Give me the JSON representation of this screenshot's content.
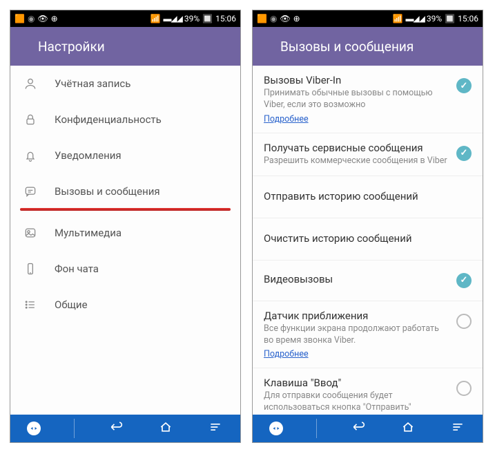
{
  "status": {
    "battery": "39%",
    "time": "15:06"
  },
  "screen1": {
    "title": "Настройки",
    "items": [
      {
        "label": "Учётная запись"
      },
      {
        "label": "Конфиденциальность"
      },
      {
        "label": "Уведомления"
      },
      {
        "label": "Вызовы и сообщения"
      },
      {
        "label": "Мультимедиа"
      },
      {
        "label": "Фон чата"
      },
      {
        "label": "Общие"
      }
    ]
  },
  "screen2": {
    "title": "Вызовы и сообщения",
    "rows": [
      {
        "title": "Вызовы Viber-In",
        "sub": "Принимать обычные вызовы с помощью Viber, если это возможно",
        "link": "Подробнее",
        "checked": true
      },
      {
        "title": "Получать сервисные сообщения",
        "sub": "Разрешить коммерческие сообщения в Viber",
        "checked": true
      },
      {
        "title": "Отправить историю сообщений"
      },
      {
        "title": "Очистить историю сообщений"
      },
      {
        "title": "Видеовызовы",
        "checked": true
      },
      {
        "title": "Датчик приближения",
        "sub": "Все функции экрана продолжают работать во время звонка Viber.",
        "link": "Подробнее",
        "checked": false
      },
      {
        "title": "Клавиша \"Ввод\"",
        "sub": "Для отправки сообщения будет использоваться кнопка \"Отправить\"",
        "checked": false
      }
    ]
  }
}
